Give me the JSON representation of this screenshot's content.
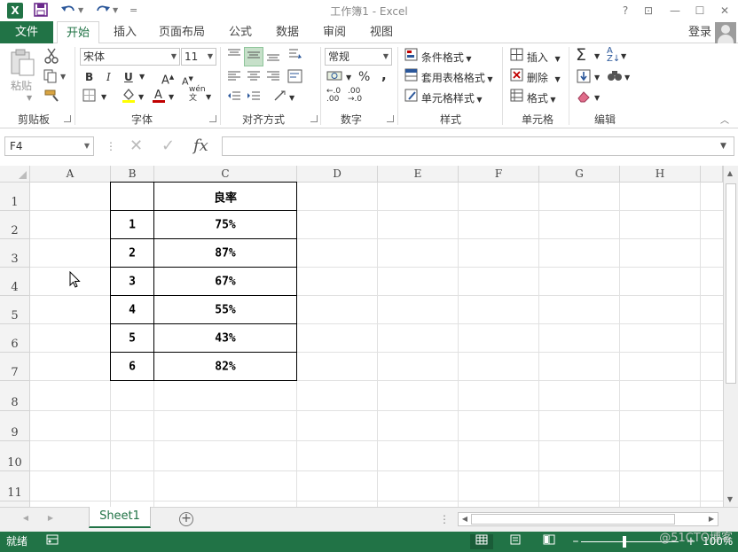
{
  "window": {
    "title": "工作簿1 - Excel",
    "app_icon": "X",
    "help": "?",
    "restore_ribbon": "⊡",
    "minimize": "—",
    "maximize": "☐",
    "close": "✕"
  },
  "qat": {
    "save_icon": "save-icon",
    "undo_icon": "undo-icon",
    "redo_icon": "redo-icon",
    "customize": "="
  },
  "tabs": {
    "file": "文件",
    "items": [
      "开始",
      "插入",
      "页面布局",
      "公式",
      "数据",
      "审阅",
      "视图"
    ],
    "active": "开始",
    "login": "登录"
  },
  "ribbon": {
    "clipboard": {
      "paste": "粘贴",
      "label": "剪贴板"
    },
    "font": {
      "name": "宋体",
      "size": "11",
      "bold": "B",
      "italic": "I",
      "underline": "U",
      "grow": "A",
      "shrink": "A",
      "wen": "wén",
      "label": "字体"
    },
    "align": {
      "label": "对齐方式"
    },
    "number": {
      "format": "常规",
      "percent": "%",
      "comma": ",",
      "label": "数字"
    },
    "styles": {
      "cond": "条件格式",
      "table": "套用表格格式",
      "cell": "单元格样式",
      "label": "样式"
    },
    "cells": {
      "insert": "插入",
      "delete": "删除",
      "format": "格式",
      "label": "单元格"
    },
    "editing": {
      "sum": "Σ",
      "label": "编辑"
    }
  },
  "formula_bar": {
    "name_box": "F4",
    "cancel": "✕",
    "enter": "✓",
    "fx": "fx",
    "value": ""
  },
  "grid": {
    "columns": [
      "A",
      "B",
      "C",
      "D",
      "E",
      "F",
      "G",
      "H"
    ],
    "rows": [
      "1",
      "2",
      "3",
      "4",
      "5",
      "6",
      "7",
      "8",
      "9",
      "10",
      "11"
    ],
    "header_c": "良率",
    "table": [
      {
        "b": "1",
        "c": "75%"
      },
      {
        "b": "2",
        "c": "87%"
      },
      {
        "b": "3",
        "c": "67%"
      },
      {
        "b": "4",
        "c": "55%"
      },
      {
        "b": "5",
        "c": "43%"
      },
      {
        "b": "6",
        "c": "82%"
      }
    ]
  },
  "sheets": {
    "tabs": [
      "Sheet1"
    ],
    "add": "+"
  },
  "status": {
    "ready": "就绪",
    "zoom": "100%"
  },
  "watermark": "@51CTO博客"
}
